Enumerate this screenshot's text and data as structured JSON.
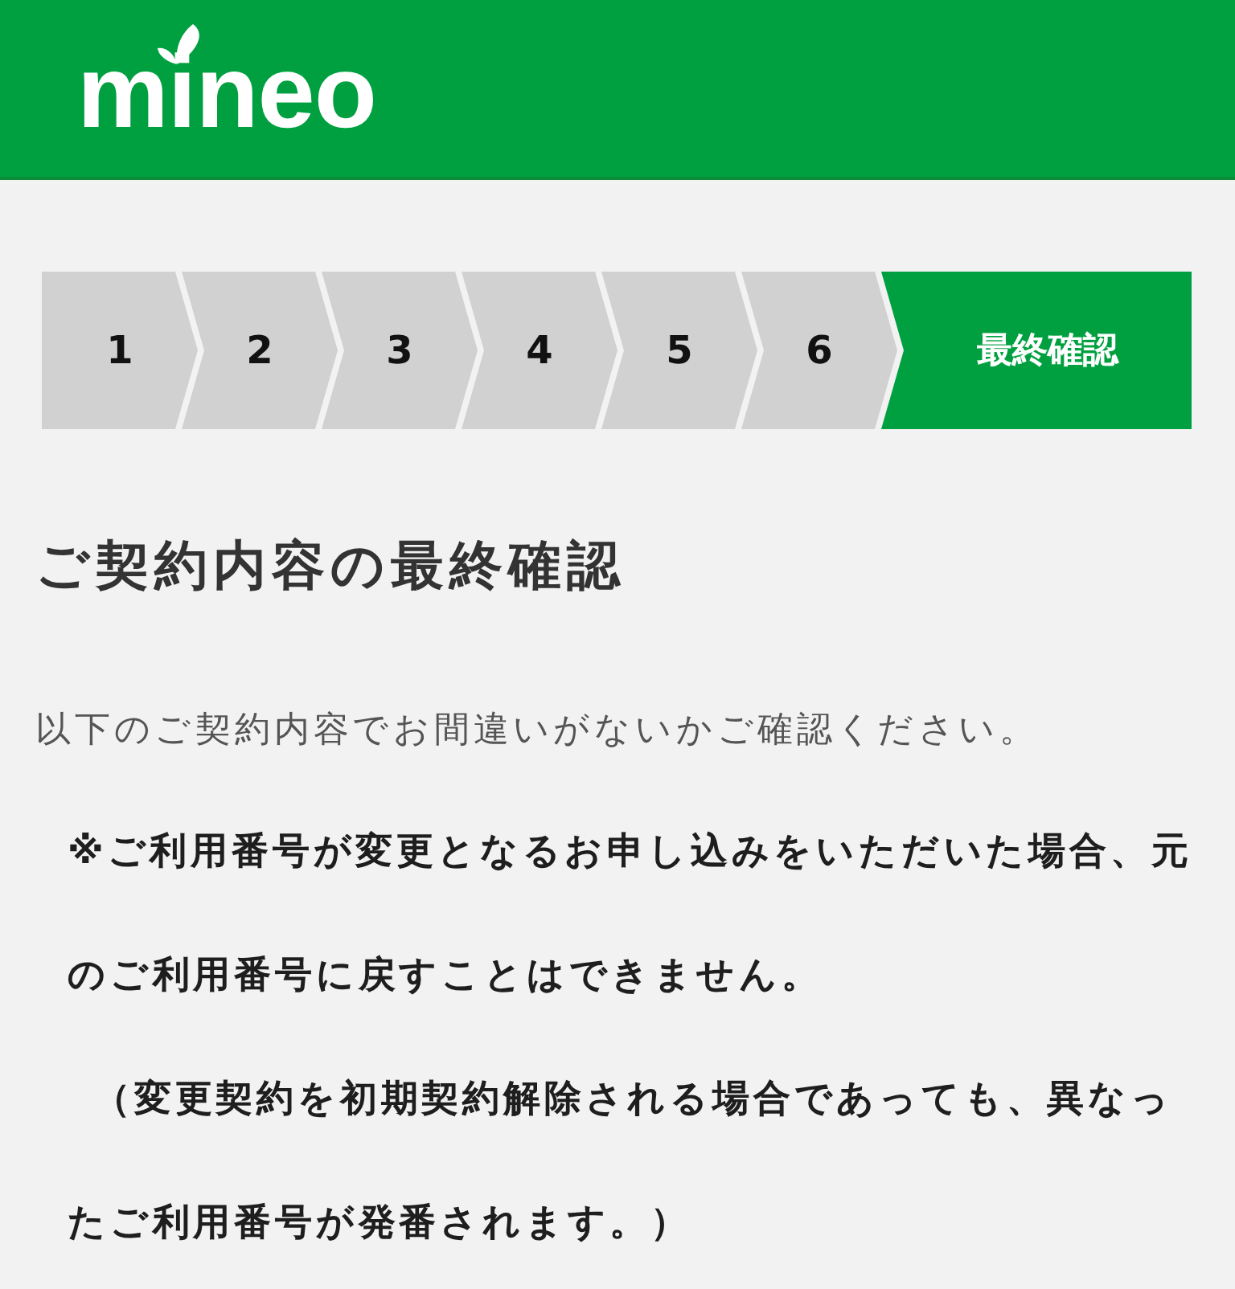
{
  "header": {
    "logo": "mineo"
  },
  "steps": [
    {
      "label": "1",
      "selected": false
    },
    {
      "label": "2",
      "selected": false
    },
    {
      "label": "3",
      "selected": false
    },
    {
      "label": "4",
      "selected": false
    },
    {
      "label": "5",
      "selected": false
    },
    {
      "label": "6",
      "selected": false
    },
    {
      "label": "最終確認",
      "selected": true
    }
  ],
  "title": "ご契約内容の最終確認",
  "intro": "以下のご契約内容でお間違いがないかご確認ください。",
  "notice": [
    "※ご利用番号が変更となるお申し込みをいただいた場合、元のご利用番号に戻すことはできません。",
    "（変更契約を初期契約解除される場合であっても、異なったご利用番号が発番されます。）"
  ]
}
